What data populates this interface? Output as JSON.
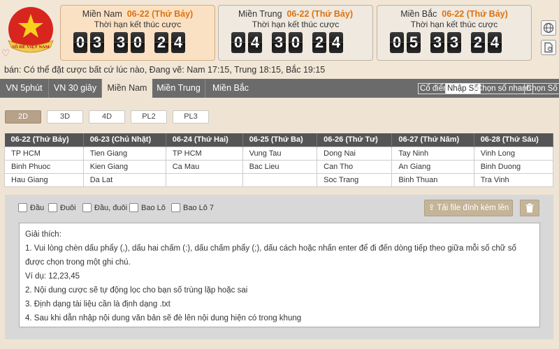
{
  "header": {
    "logo_text": "SỔ ĐỀ VIỆT NAM",
    "regions": [
      {
        "name": "Miền Nam",
        "date": "06-22 (Thứ Bảy)",
        "subtitle": "Thời hạn kết thúc cược",
        "digits": [
          "0",
          "3",
          "3",
          "0",
          "2",
          "4"
        ]
      },
      {
        "name": "Miền Trung",
        "date": "06-22 (Thứ Bảy)",
        "subtitle": "Thời hạn kết thúc cược",
        "digits": [
          "0",
          "4",
          "3",
          "0",
          "2",
          "4"
        ]
      },
      {
        "name": "Miền Bắc",
        "date": "06-22 (Thứ Bảy)",
        "subtitle": "Thời hạn kết thúc cược",
        "digits": [
          "0",
          "5",
          "3",
          "3",
          "2",
          "4"
        ]
      }
    ]
  },
  "info_text": "bán: Có thể đặt cược bất cứ lúc nào,   Đang vẽ: Nam 17:15, Trung 18:15, Bắc 19:15",
  "nav": {
    "tabs": [
      "VN 5phút",
      "VN 30 giây",
      "Miền Nam",
      "Miền Trung",
      "Miền Bắc"
    ],
    "modes": [
      "Cổ điển",
      "Nhập Số",
      "Chọn số nhanh",
      "Chọn Số"
    ]
  },
  "bet_types": [
    "2D",
    "3D",
    "4D",
    "PL2",
    "PL3"
  ],
  "schedule": {
    "headers": [
      "06-22 (Thứ Bảy)",
      "06-23 (Chủ Nhật)",
      "06-24 (Thứ Hai)",
      "06-25 (Thứ Ba)",
      "06-26 (Thứ Tư)",
      "06-27 (Thứ Năm)",
      "06-28 (Thứ Sáu)"
    ],
    "rows": [
      [
        "TP HCM",
        "Tien Giang",
        "TP HCM",
        "Vung Tau",
        "Dong Nai",
        "Tay Ninh",
        "Vinh Long"
      ],
      [
        "Binh Phuoc",
        "Kien Giang",
        "Ca Mau",
        "Bac Lieu",
        "Can Tho",
        "An Giang",
        "Binh Duong"
      ],
      [
        "Hau Giang",
        "Da Lat",
        "",
        "",
        "Soc Trang",
        "Binh Thuan",
        "Tra Vinh"
      ]
    ]
  },
  "options": [
    "Đầu",
    "Đuôi",
    "Đầu, đuôi",
    "Bao Lô",
    "Bao Lô 7"
  ],
  "upload_label": "Tải file đính kèm lên",
  "notes": [
    "Giải thích:",
    "1. Vui lòng chèn dấu phẩy (,), dấu hai chấm (:), dấu chấm phẩy (;), dấu cách hoặc nhấn enter để đi đến dòng tiếp theo giữa mỗi số chữ số",
    "được chọn trong một ghi chú.",
    "Ví dụ: 12,23,45",
    "2. Nội dung cược sẽ tự động lọc cho bạn số trùng lặp hoặc sai",
    "3. Định dạng tài liệu cần là định dạng .txt",
    "4. Sau khi dẫn nhập nội dung văn bản sẽ đè lên nội dung hiện có trong khung"
  ],
  "colors": {
    "accent": "#e0720c",
    "nav_bg": "#6b6b6b",
    "button_tan": "#c4b498"
  }
}
